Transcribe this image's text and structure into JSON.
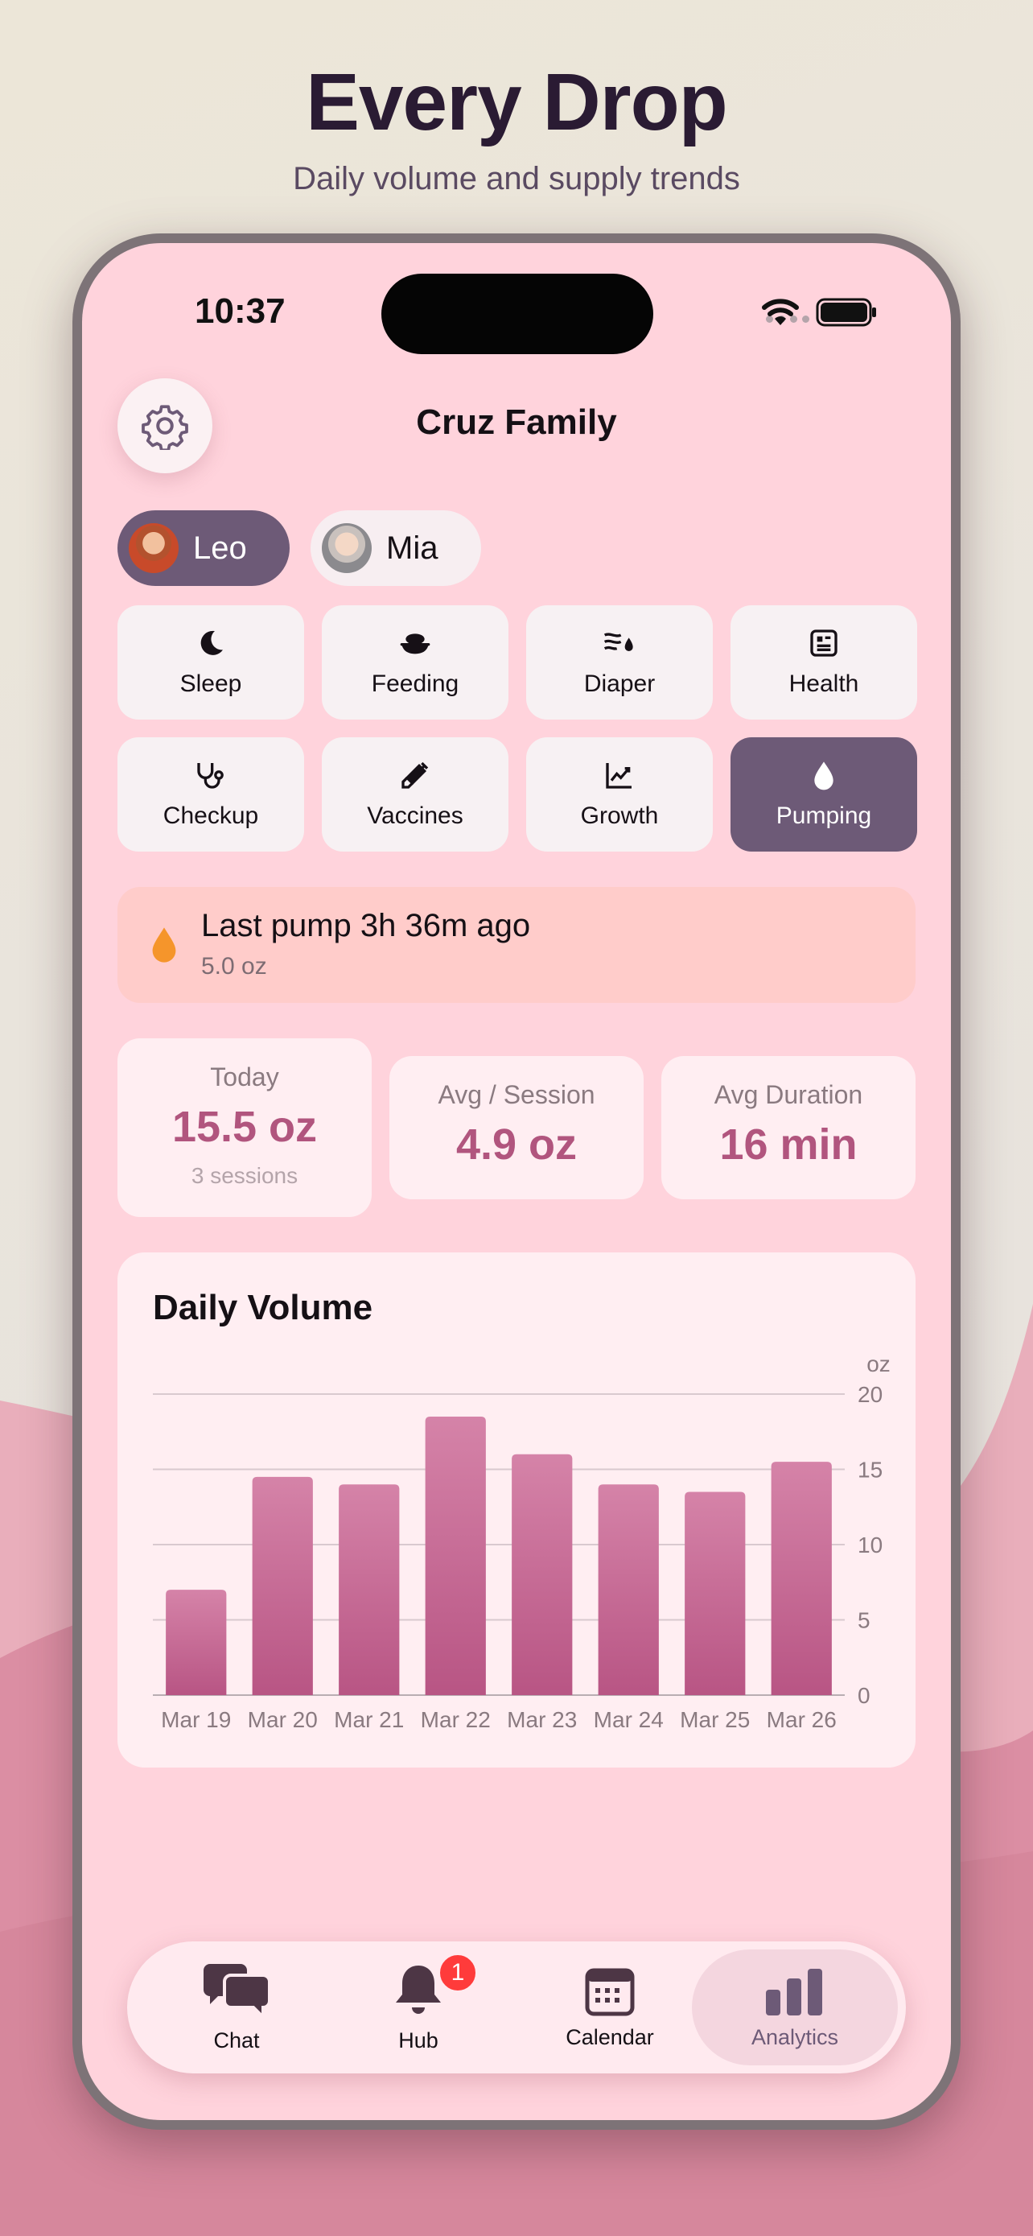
{
  "hero": {
    "title": "Every Drop",
    "subtitle": "Daily volume and supply trends"
  },
  "status_bar": {
    "time": "10:37"
  },
  "header": {
    "family_name": "Cruz Family"
  },
  "children": [
    {
      "name": "Leo",
      "selected": true
    },
    {
      "name": "Mia",
      "selected": false
    }
  ],
  "categories": [
    {
      "label": "Sleep",
      "icon": "moon-icon"
    },
    {
      "label": "Feeding",
      "icon": "bowl-icon"
    },
    {
      "label": "Diaper",
      "icon": "diaper-icon"
    },
    {
      "label": "Health",
      "icon": "health-card-icon"
    },
    {
      "label": "Checkup",
      "icon": "stethoscope-icon"
    },
    {
      "label": "Vaccines",
      "icon": "syringe-icon"
    },
    {
      "label": "Growth",
      "icon": "growth-chart-icon"
    },
    {
      "label": "Pumping",
      "icon": "drop-icon",
      "active": true
    }
  ],
  "last_pump": {
    "title": "Last pump 3h 36m ago",
    "subtitle": "5.0 oz"
  },
  "stats": {
    "today": {
      "title": "Today",
      "value": "15.5 oz",
      "sub": "3 sessions"
    },
    "avg_session": {
      "title": "Avg / Session",
      "value": "4.9 oz"
    },
    "avg_duration": {
      "title": "Avg Duration",
      "value": "16 min"
    }
  },
  "chart_data": {
    "type": "bar",
    "title": "Daily Volume",
    "xlabel": "",
    "ylabel": "oz",
    "categories": [
      "Mar 19",
      "Mar 20",
      "Mar 21",
      "Mar 22",
      "Mar 23",
      "Mar 24",
      "Mar 25",
      "Mar 26"
    ],
    "values": [
      7,
      14.5,
      14,
      18.5,
      16,
      14,
      13.5,
      15.5
    ],
    "ylim": [
      0,
      20
    ],
    "yticks": [
      0,
      5,
      10,
      15,
      20
    ],
    "grid": true,
    "color": "#c0628f"
  },
  "tabbar": {
    "items": [
      {
        "label": "Chat",
        "icon": "chat-bubbles-icon"
      },
      {
        "label": "Hub",
        "icon": "bell-icon",
        "badge": "1"
      },
      {
        "label": "Calendar",
        "icon": "calendar-icon"
      },
      {
        "label": "Analytics",
        "icon": "bar-chart-icon",
        "active": true
      }
    ]
  },
  "colors": {
    "accent": "#6d5a77",
    "screen_bg": "#ffd3dc",
    "bar": "#c0628f",
    "value_text": "#b1557e"
  }
}
